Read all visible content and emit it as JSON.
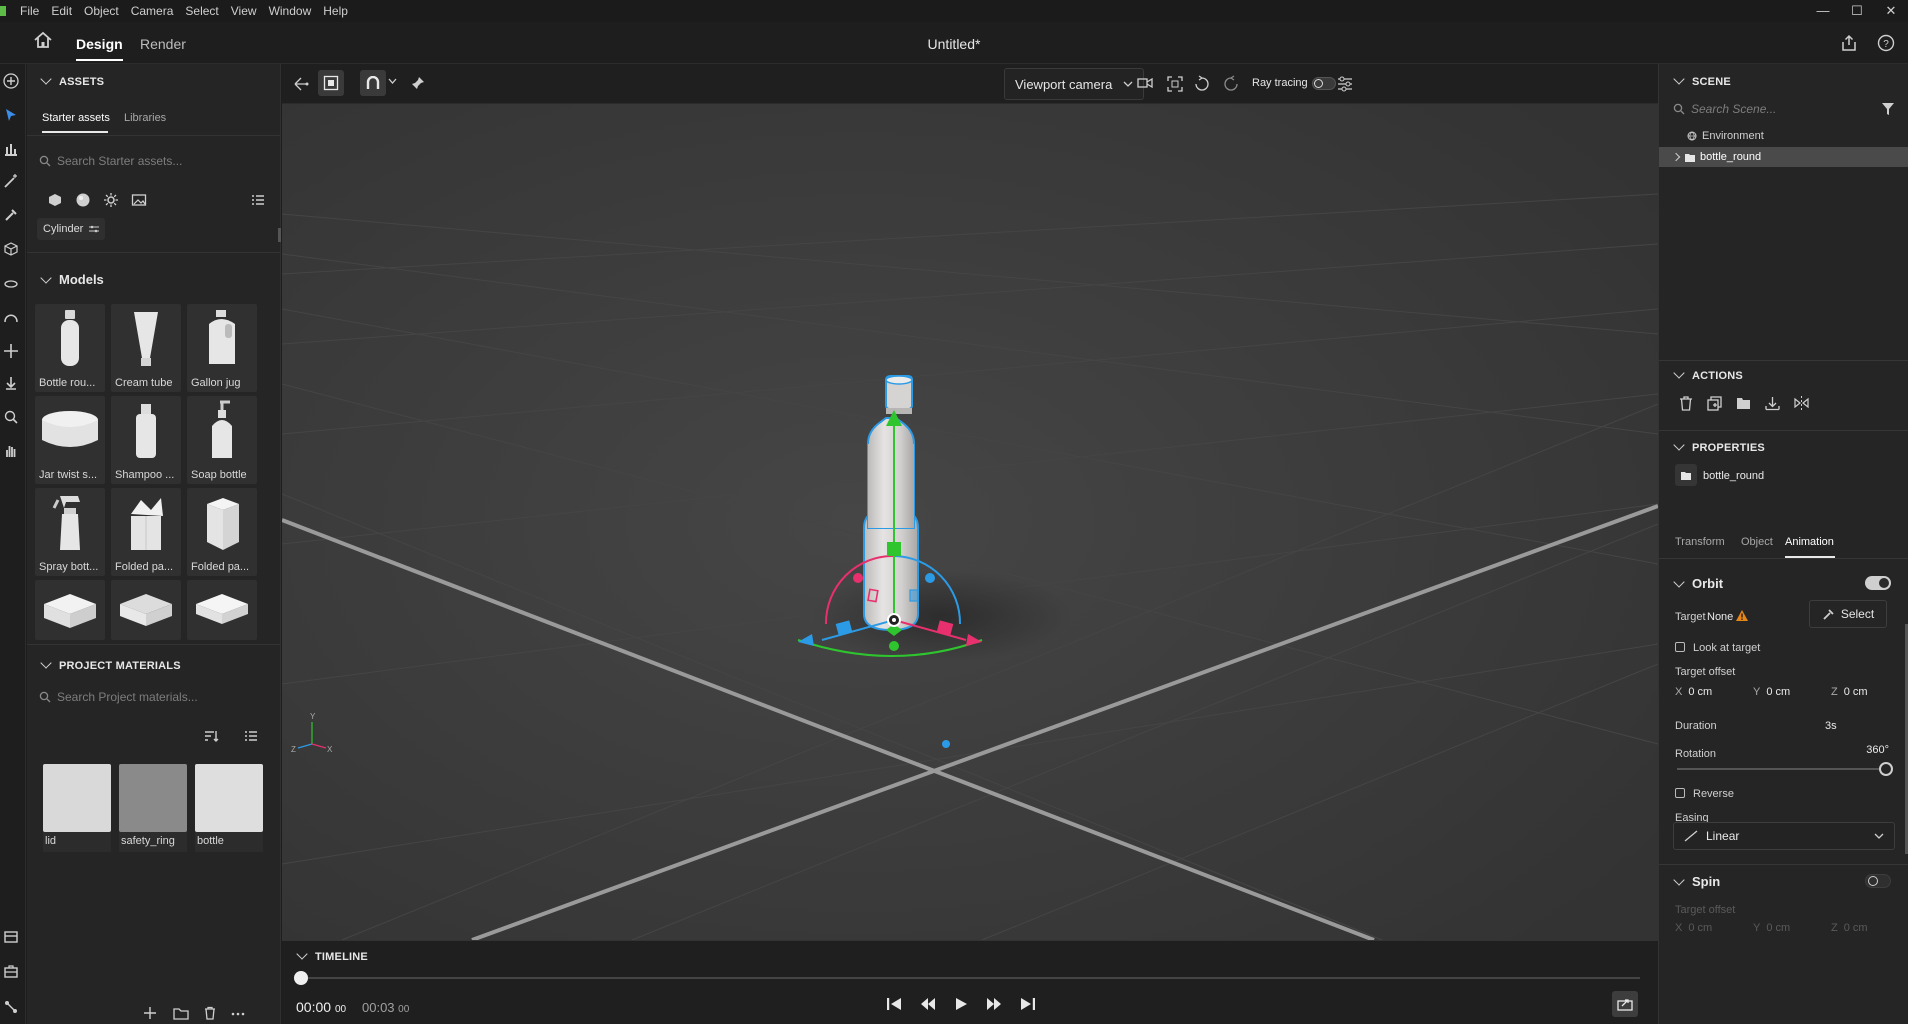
{
  "menubar": {
    "items": [
      "File",
      "Edit",
      "Object",
      "Camera",
      "Select",
      "View",
      "Window",
      "Help"
    ]
  },
  "window_controls": {
    "minimize": "—",
    "maximize": "☐",
    "close": "✕"
  },
  "header": {
    "tabs": [
      {
        "label": "Design",
        "active": true
      },
      {
        "label": "Render",
        "active": false
      }
    ],
    "title": "Untitled*"
  },
  "assets": {
    "section_title": "ASSETS",
    "tabs": [
      {
        "label": "Starter assets",
        "active": true
      },
      {
        "label": "Libraries",
        "active": false
      }
    ],
    "search_placeholder": "Search Starter assets...",
    "filter_chip": "Cylinder",
    "models_title": "Models",
    "models": [
      {
        "label": "Bottle rou...",
        "icon": "bottle-icon"
      },
      {
        "label": "Cream tube",
        "icon": "tube-icon"
      },
      {
        "label": "Gallon jug",
        "icon": "jug-icon"
      },
      {
        "label": "Jar twist s...",
        "icon": "jar-icon"
      },
      {
        "label": "Shampoo ...",
        "icon": "shampoo-icon"
      },
      {
        "label": "Soap bottle",
        "icon": "soap-bottle-icon"
      },
      {
        "label": "Spray bott...",
        "icon": "spray-bottle-icon"
      },
      {
        "label": "Folded pa...",
        "icon": "folded-box-icon"
      },
      {
        "label": "Folded pa...",
        "icon": "box-icon"
      },
      {
        "label": "",
        "icon": "flat-box-icon"
      },
      {
        "label": "",
        "icon": "tray-icon"
      },
      {
        "label": "",
        "icon": "flat-box-icon"
      }
    ]
  },
  "project_materials": {
    "section_title": "PROJECT MATERIALS",
    "search_placeholder": "Search Project materials...",
    "materials": [
      {
        "label": "lid",
        "color": "#d9d9d9"
      },
      {
        "label": "safety_ring",
        "color": "#8a8a8a"
      },
      {
        "label": "bottle",
        "color": "#dedede"
      }
    ]
  },
  "viewport_toolbar": {
    "camera_select": "Viewport camera",
    "ray_tracing_label": "Ray tracing",
    "ray_tracing_on": false
  },
  "timeline": {
    "title": "TIMELINE",
    "current_time": "00:00",
    "current_frames": "00",
    "end_time": "00:03",
    "end_frames": "00",
    "progress": 0
  },
  "scene": {
    "title": "SCENE",
    "search_placeholder": "Search Scene...",
    "items": [
      {
        "label": "Environment",
        "icon": "globe-icon",
        "selected": false
      },
      {
        "label": "bottle_round",
        "icon": "folder-icon",
        "selected": true
      }
    ]
  },
  "actions": {
    "title": "ACTIONS"
  },
  "properties": {
    "title": "PROPERTIES",
    "object_name": "bottle_round",
    "tabs": [
      {
        "label": "Transform",
        "active": false
      },
      {
        "label": "Object",
        "active": false
      },
      {
        "label": "Animation",
        "active": true
      }
    ],
    "orbit": {
      "title": "Orbit",
      "enabled": true,
      "target_label": "Target",
      "target_value": "None",
      "select_button": "Select",
      "look_at_target": "Look at target",
      "target_offset_label": "Target offset",
      "offset": [
        {
          "axis": "X",
          "value": "0 cm"
        },
        {
          "axis": "Y",
          "value": "0 cm"
        },
        {
          "axis": "Z",
          "value": "0 cm"
        }
      ],
      "duration_label": "Duration",
      "duration_value": "3s",
      "rotation_label": "Rotation",
      "rotation_value": "360°",
      "rotation_fraction": 1.0,
      "reverse_label": "Reverse",
      "easing_label": "Easing",
      "easing_value": "Linear"
    },
    "spin": {
      "title": "Spin",
      "enabled": false,
      "target_offset_label": "Target offset",
      "offset": [
        {
          "axis": "X",
          "value": "0 cm"
        },
        {
          "axis": "Y",
          "value": "0 cm"
        },
        {
          "axis": "Z",
          "value": "0 cm"
        }
      ]
    }
  },
  "colors": {
    "accent": "#2680eb",
    "gizmo_y": "#2fc52f",
    "gizmo_x": "#e8306e",
    "gizmo_z": "#2c9be6",
    "warning": "#e68619"
  }
}
